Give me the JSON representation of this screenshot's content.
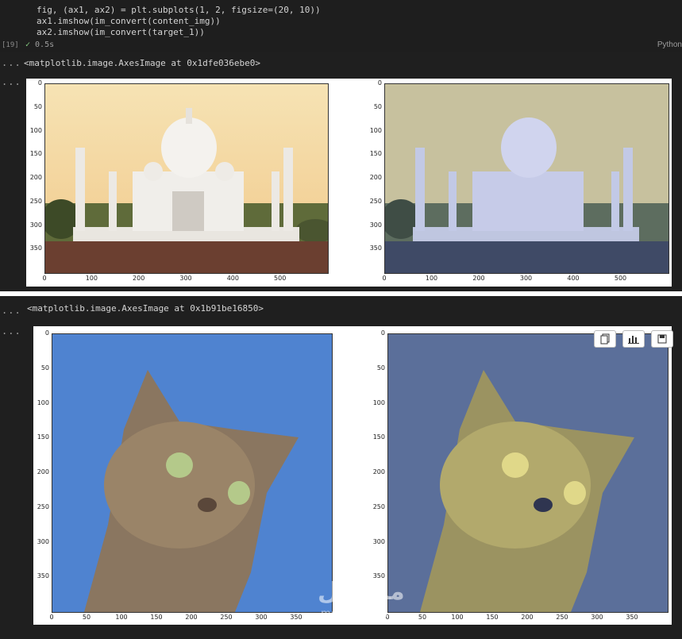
{
  "code": {
    "lines": [
      "fig, (ax1, ax2) = plt.subplots(1, 2, figsize=(20, 10))",
      "ax1.imshow(im_convert(content_img))",
      "ax2.imshow(im_convert(target_1))"
    ],
    "execution_count": "[19]",
    "duration": "0.5s",
    "language": "Python"
  },
  "output1": {
    "text": "<matplotlib.image.AxesImage at 0x1dfe036ebe0>",
    "yticks": [
      "0",
      "50",
      "100",
      "150",
      "200",
      "250",
      "300",
      "350"
    ],
    "xticks": [
      "0",
      "100",
      "200",
      "300",
      "400",
      "500"
    ]
  },
  "output2": {
    "text": "<matplotlib.image.AxesImage at 0x1b91be16850>",
    "yticks": [
      "0",
      "50",
      "100",
      "150",
      "200",
      "250",
      "300",
      "350"
    ],
    "xticks": [
      "0",
      "50",
      "100",
      "150",
      "200",
      "250",
      "300",
      "350"
    ]
  },
  "ellipsis": "...",
  "watermark": {
    "arabic": "مستقل",
    "latin": "mostaql.com"
  },
  "icons": {
    "copy": "copy-icon",
    "chart": "bar-chart-icon",
    "save": "save-icon"
  }
}
